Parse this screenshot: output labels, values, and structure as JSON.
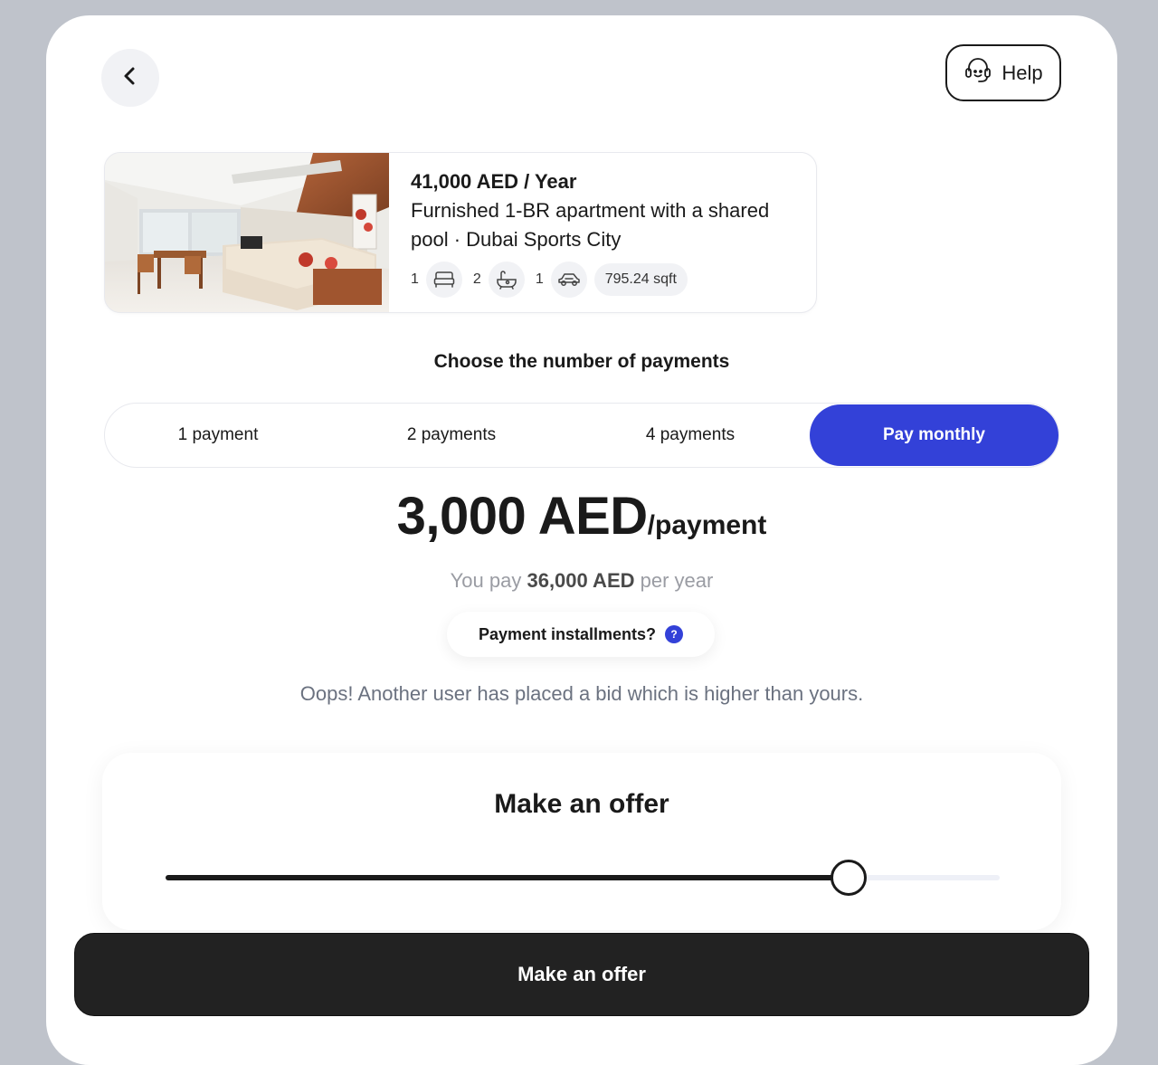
{
  "help": {
    "label": "Help"
  },
  "listing": {
    "price": "41,000 AED / Year",
    "description": "Furnished 1-BR apartment with a shared pool · Dubai Sports City",
    "bedrooms": "1",
    "bathrooms": "2",
    "parking": "1",
    "area": "795.24 sqft"
  },
  "payments": {
    "heading": "Choose the number of payments",
    "options": [
      {
        "label": "1 payment"
      },
      {
        "label": "2 payments"
      },
      {
        "label": "4 payments"
      },
      {
        "label": "Pay monthly"
      }
    ],
    "selected_index": 3
  },
  "amount": {
    "value": "3,000 AED",
    "unit": "/payment",
    "yearly_prefix": "You pay",
    "yearly_value": "36,000 AED",
    "yearly_suffix": "per year"
  },
  "installments": {
    "label": "Payment installments?",
    "badge": "?"
  },
  "notice": "Oops! Another user has placed a bid which is higher than yours.",
  "offer": {
    "title": "Make an offer",
    "slider_fraction": 0.819,
    "button_label": "Make an offer"
  },
  "colors": {
    "accent": "#3341d8",
    "dark": "#222222",
    "muted_text": "#6b7280"
  },
  "icons": {
    "back": "chevron-left-icon",
    "help": "headset-icon",
    "bed": "bed-icon",
    "bath": "bathtub-icon",
    "car": "car-icon",
    "question": "question-icon"
  }
}
